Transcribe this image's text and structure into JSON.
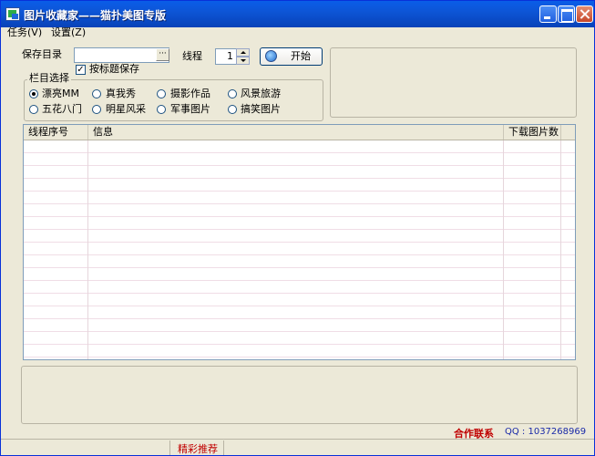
{
  "window": {
    "title": "图片收藏家——猫扑美图专版"
  },
  "menu": [
    "任务(V)",
    "设置(Z)"
  ],
  "form": {
    "save_dir_label": "保存目录",
    "save_dir_value": "",
    "browse_label": "···",
    "by_title_label": "按标题保存",
    "by_title_checked": true,
    "thread_label": "线程",
    "thread_value": "1",
    "start_label": "开始"
  },
  "category": {
    "title": "栏目选择",
    "options": [
      "漂亮MM",
      "真我秀",
      "摄影作品",
      "风景旅游",
      "五花八门",
      "明星风采",
      "军事图片",
      "搞笑图片"
    ],
    "selected": "漂亮MM"
  },
  "table": {
    "columns": [
      "线程序号",
      "信息",
      "下载图片数"
    ],
    "rows": []
  },
  "footer": {
    "contact_label": "合作联系",
    "qq_label": "QQ : 1037268969",
    "status_label": "精彩推荐"
  },
  "colors": {
    "titlebar": "#0a5de8",
    "accent_red": "#c00000",
    "qq_blue": "#1a2aa8",
    "row_line": "#f0dde6"
  }
}
